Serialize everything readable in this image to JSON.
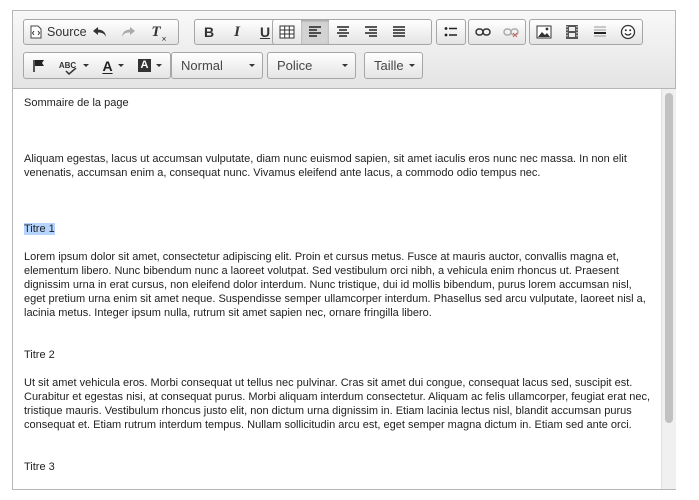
{
  "toolbar": {
    "source_label": "Source",
    "format_value": "Normal",
    "font_value": "Police",
    "size_value": "Taille",
    "font_color_letter": "A",
    "bg_color_letter": "A",
    "spellcheck_label": "ABC",
    "bold_label": "B",
    "italic_label": "I",
    "underline_label": "U",
    "clear_format_label": "T"
  },
  "content": {
    "p1": "Sommaire de la page",
    "p2": "Aliquam egestas, lacus ut accumsan vulputate, diam nunc euismod sapien, sit amet iaculis eros nunc nec massa. In non elit venenatis, accumsan enim a, consequat nunc. Vivamus eleifend ante lacus, a commodo odio tempus nec.",
    "h1": "Titre 1",
    "p3": "Lorem ipsum dolor sit amet, consectetur adipiscing elit. Proin et cursus metus. Fusce at mauris auctor, convallis magna et, elementum libero. Nunc bibendum nunc a laoreet volutpat. Sed vestibulum orci nibh, a vehicula enim rhoncus ut. Praesent dignissim urna in erat cursus, non eleifend dolor interdum. Nunc tristique, dui id mollis bibendum, purus lorem accumsan nisl, eget pretium urna enim sit amet neque. Suspendisse semper ullamcorper interdum. Phasellus sed arcu vulputate, laoreet nisl a, lacinia metus. Integer ipsum nulla, rutrum sit amet sapien nec, ornare fringilla libero.",
    "h2": "Titre 2",
    "p4": "Ut sit amet vehicula eros. Morbi consequat ut tellus nec pulvinar. Cras sit amet dui congue, consequat lacus sed, suscipit est. Curabitur et egestas nisi, at consequat purus. Morbi aliquam interdum consectetur. Aliquam ac felis ullamcorper, feugiat erat nec, tristique mauris. Vestibulum rhoncus justo elit, non dictum urna dignissim in. Etiam lacinia lectus nisl, blandit accumsan purus consequat et. Etiam rutrum interdum tempus. Nullam sollicitudin arcu est, eget semper magna dictum in. Etiam sed ante orci.",
    "h3": "Titre 3"
  },
  "colors": {
    "selection": "#b5d5ff",
    "toolbar_top": "#f8f8f8",
    "toolbar_bottom": "#e4e4e4",
    "active_button": "#d3d3d3"
  }
}
